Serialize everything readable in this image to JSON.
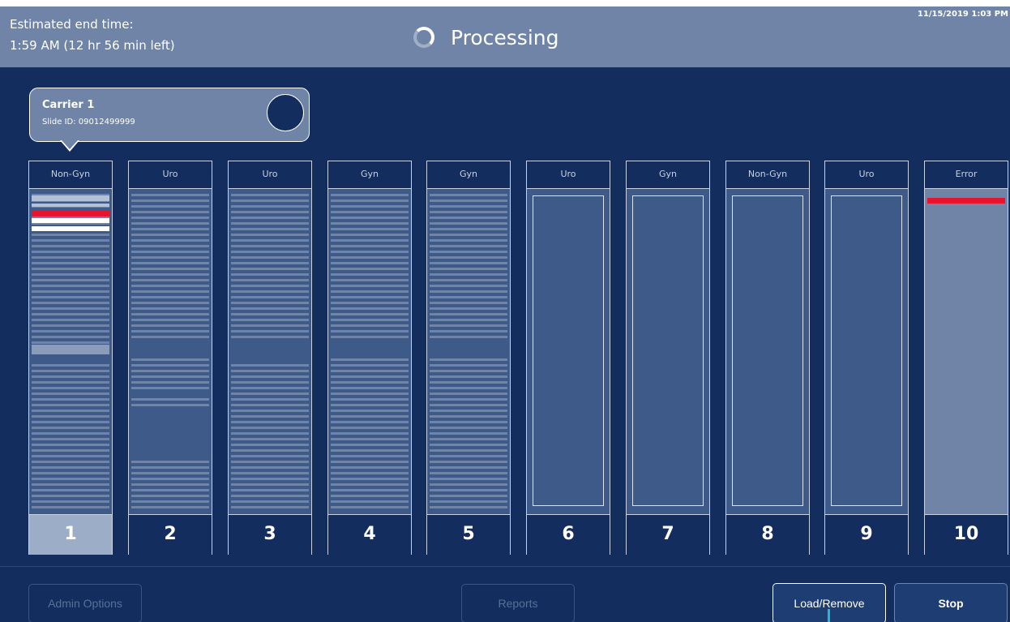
{
  "header": {
    "est_label": "Estimated end time:",
    "est_value": "1:59 AM (12 hr 56 min left)",
    "status": "Processing",
    "datetime": "11/15/2019 1:03 PM"
  },
  "popup": {
    "title": "Carrier 1",
    "slide_id": "Slide ID: 09012499999"
  },
  "carriers": [
    {
      "label": "Non-Gyn",
      "num": "1",
      "state": "loaded",
      "active": true
    },
    {
      "label": "Uro",
      "num": "2",
      "state": "loaded"
    },
    {
      "label": "Uro",
      "num": "3",
      "state": "loaded"
    },
    {
      "label": "Gyn",
      "num": "4",
      "state": "loaded"
    },
    {
      "label": "Gyn",
      "num": "5",
      "state": "loaded"
    },
    {
      "label": "Uro",
      "num": "6",
      "state": "empty"
    },
    {
      "label": "Gyn",
      "num": "7",
      "state": "empty"
    },
    {
      "label": "Non-Gyn",
      "num": "8",
      "state": "empty"
    },
    {
      "label": "Uro",
      "num": "9",
      "state": "empty"
    },
    {
      "label": "Error",
      "num": "10",
      "state": "error"
    }
  ],
  "footer": {
    "admin_options": "Admin Options",
    "reports": "Reports",
    "load_remove": "Load/Remove",
    "stop": "Stop"
  },
  "colors": {
    "background": "#122d5e",
    "header": "#6f84a6",
    "error_slide": "#e8142f",
    "slide": "#6f84a6",
    "empty_carrier": "#3d5a88"
  }
}
